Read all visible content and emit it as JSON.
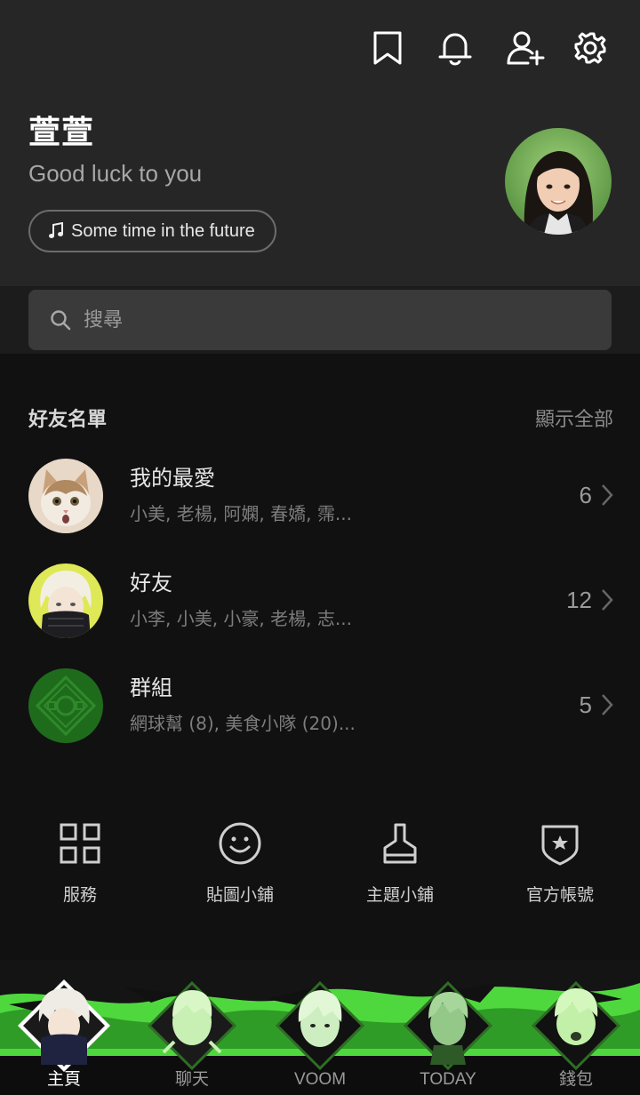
{
  "header": {
    "icons": [
      "bookmark-icon",
      "bell-icon",
      "add-friend-icon",
      "gear-icon"
    ]
  },
  "profile": {
    "name": "萱萱",
    "status_message": "Good luck to you",
    "music": "Some time in the future"
  },
  "search": {
    "placeholder": "搜尋"
  },
  "friends_section": {
    "title": "好友名單",
    "show_all": "顯示全部",
    "rows": [
      {
        "title": "我的最愛",
        "subtitle": "小美, 老楊, 阿嫻, 春嬌, 霈...",
        "count": "6"
      },
      {
        "title": "好友",
        "subtitle": "小李, 小美, 小豪, 老楊, 志...",
        "count": "12"
      },
      {
        "title": "群組",
        "subtitle": "網球幫 (8), 美食小隊 (20)...",
        "count": "5"
      }
    ]
  },
  "shortcuts": [
    {
      "label": "服務",
      "icon": "grid-icon"
    },
    {
      "label": "貼圖小鋪",
      "icon": "smiley-icon"
    },
    {
      "label": "主題小鋪",
      "icon": "brush-icon"
    },
    {
      "label": "官方帳號",
      "icon": "shield-star-icon"
    }
  ],
  "bottom_nav": {
    "tabs": [
      {
        "label": "主頁",
        "active": true
      },
      {
        "label": "聊天",
        "active": false
      },
      {
        "label": "VOOM",
        "active": false
      },
      {
        "label": "TODAY",
        "active": false
      },
      {
        "label": "錢包",
        "active": false
      }
    ]
  },
  "colors": {
    "header_bg": "#262626",
    "body_bg": "#111111",
    "accent_green": "#5bf04a",
    "search_bg": "#3a3a3a"
  }
}
